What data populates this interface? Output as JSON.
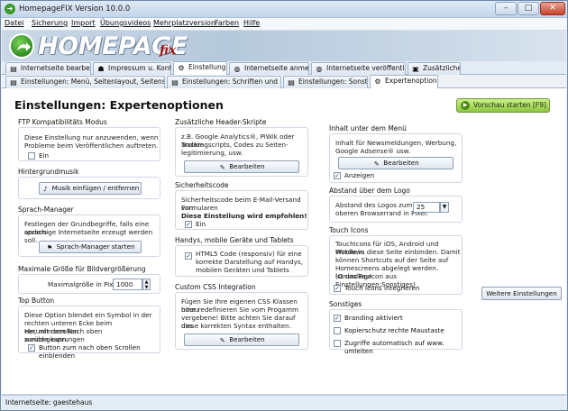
{
  "window": {
    "title": "HomepageFIX      Version 10.0.0",
    "min": "–",
    "max": "□",
    "close": "✕"
  },
  "menu": [
    "Datei",
    "Sicherung",
    "Import",
    "Übungsvideos",
    "Mehrplatzversion",
    "Farben",
    "Hilfe"
  ],
  "banner": {
    "logo_text": "HOMEPAGE",
    "logo_sub": "fix"
  },
  "tabs1": [
    "Internetseite bearbeiten",
    "Impressum u. Kontakt",
    "Einstellungen",
    "Internetseite anmelden",
    "Internetseite veröffentlichen",
    "Zusätzliches"
  ],
  "tabs2": [
    "Einstellungen: Menü, Seitenlayout, Seitenstruktur",
    "Einstellungen: Schriften und Farben",
    "Einstellungen: Sonstiges",
    "Expertenoptionen"
  ],
  "page": {
    "title": "Einstellungen: Expertenoptionen",
    "preview": "Vorschau starten [F9]"
  },
  "ftp": {
    "title": "FTP Kompatibilitäts Modus",
    "text1": "Diese Einstellung nur anzuwenden, wenn",
    "text2": "Probleme beim Veröffentlichen auftreten.",
    "cb_label": "Ein",
    "checked": false
  },
  "music": {
    "title": "Hintergrundmusik",
    "button": "Musik einfügen / entfernen"
  },
  "lang": {
    "title": "Sprach-Manager",
    "text1": "Festlegen der Grundbegriffe, falls eine anders-",
    "text2": "sprachige Internetseite erzeugt werden soll.",
    "button": "Sprach-Manager starten"
  },
  "imgsize": {
    "title": "Maximale Größe für Bildvergrößerung",
    "label": "Maximalgröße in Pixel",
    "value": "1000"
  },
  "topbtn": {
    "title": "Top Button",
    "text1": "Diese Option blendet ein Symbol in der",
    "text2": "rechten unteren Ecke beim Herunterscrollen",
    "text3": "ein, mit dem Nach oben zurückgesprungen",
    "text4": "werden kann.",
    "cb_label": "Button zum nach oben Scrollen einblenden",
    "checked": true
  },
  "header": {
    "title": "Zusätzliche Header-Skripte",
    "text1": "z.B. Google Analytics®, PiWik oder andere",
    "text2": "Trackingscripts, Codes zu Seiten-",
    "text3": "legitimierung, usw.",
    "button": "Bearbeiten"
  },
  "security": {
    "title": "Sicherheitscode",
    "text1": "Sicherheitscode beim E-Mail-Versand von",
    "text2": "Formularen",
    "bold": "Diese Einstellung wird empfohlen!",
    "cb_label": "Ein",
    "checked": true
  },
  "mobile": {
    "title": "Handys, mobile Geräte und Tablets",
    "text1": "HTML5 Code (responsiv) für eine",
    "text2": "korrekte Darstellung auf Handys,",
    "text3": "mobilen Geräten und Tablets",
    "checked": true
  },
  "css": {
    "title": "Custom CSS Integration",
    "text1": "Fügen Sie Ihre eigenen CSS Klassen hinzu",
    "text2": "oder redefinieren Sie vom Progamm",
    "text3": "vergebene! Bitte achten Sie darauf das",
    "text4": "diese korrekten Syntax enthalten.",
    "button": "Bearbeiten"
  },
  "menucontent": {
    "title": "Inhalt unter dem Menü",
    "text1": "Inhalt für Newsmeldungen, Werbung,",
    "text2": "Google Adsense® usw.",
    "button": "Bearbeiten",
    "cb_label": "Anzeigen",
    "checked": true
  },
  "logo": {
    "title": "Abstand über dem Logo",
    "text1": "Abstand des Logos zum",
    "text2": "oberen Browserrand in Pixel:",
    "value": "25"
  },
  "touch": {
    "title": "Touch Icons",
    "text1": "Touchicons für iOS, Android und Windows",
    "text2": "Mobile in diese Seite einbinden. Damit",
    "text3": "können Shortcuts auf der Seite auf",
    "text4": "Homescreens abgelegt werden. (Grundlage",
    "text5": "ist das FavIcon aus Einstellungen:Sonstiges)",
    "cb_label": "Touch Icons integrieren",
    "checked": true
  },
  "misc": {
    "title": "Sonstiges",
    "cb1": "Branding aktiviert",
    "cb1_checked": true,
    "cb2": "Kopierschutz rechte Maustaste",
    "cb2_checked": false,
    "cb3": "Zugriffe automatisch auf www. umleiten",
    "cb3_checked": false
  },
  "more_button": "Weitere Einstellungen",
  "status": "Internetseite: gaestehaus",
  "colors": {
    "accent_green": "#8cc63f",
    "close_red": "#c7412c"
  }
}
